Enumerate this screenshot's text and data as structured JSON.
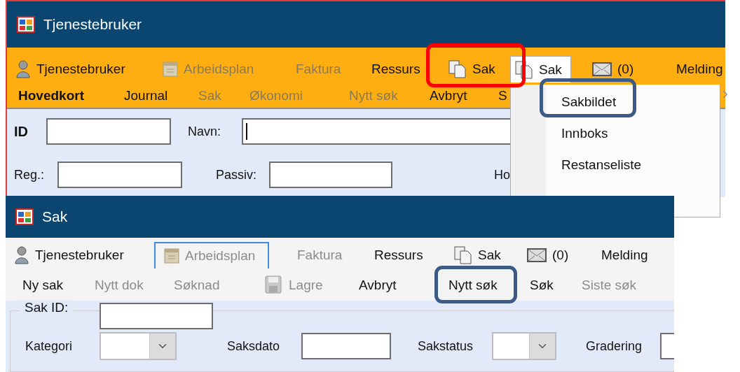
{
  "main_window": {
    "title": "Tjenestebruker",
    "nav": [
      {
        "label": "Tjenestebruker",
        "kind": "person",
        "disabled": false,
        "selected": false
      },
      {
        "label": "Arbeidsplan",
        "kind": "calendar",
        "disabled": true,
        "selected": false
      },
      {
        "label": "Faktura",
        "kind": "plain",
        "disabled": true,
        "selected": false
      },
      {
        "label": "Ressurs",
        "kind": "plain",
        "disabled": false,
        "selected": false
      },
      {
        "label": "Sak",
        "kind": "document",
        "disabled": false,
        "selected": false
      },
      {
        "label": "Sak",
        "kind": "document",
        "disabled": false,
        "selected": true
      },
      {
        "label": "(0)",
        "kind": "mail",
        "disabled": false,
        "selected": false
      },
      {
        "label": "Melding",
        "kind": "plain",
        "disabled": false,
        "selected": false
      }
    ],
    "actions": [
      {
        "label": "Hovedkort",
        "disabled": false,
        "selected": true
      },
      {
        "label": "Journal",
        "disabled": false,
        "selected": false
      },
      {
        "label": "Sak",
        "disabled": true,
        "selected": false
      },
      {
        "label": "Økonomi",
        "disabled": true,
        "selected": false
      },
      {
        "label": "Nytt søk",
        "disabled": true,
        "selected": false
      },
      {
        "label": "Avbryt",
        "disabled": false,
        "selected": false
      },
      {
        "label": "S",
        "disabled": false,
        "selected": false
      }
    ],
    "form_rows": [
      [
        {
          "label": "ID",
          "strong": true,
          "focused": false
        },
        {
          "label": "Navn:",
          "strong": false,
          "focused": true
        }
      ],
      [
        {
          "label": "Reg.:",
          "strong": false,
          "focused": false
        },
        {
          "label": "Passiv:",
          "strong": false,
          "focused": false
        }
      ]
    ],
    "cut_label": "Ho",
    "menu": [
      "Sakbildet",
      "Innboks",
      "Restanseliste"
    ]
  },
  "case_window": {
    "title": "Sak",
    "nav": [
      {
        "label": "Tjenestebruker",
        "kind": "person",
        "disabled": false,
        "selected": false
      },
      {
        "label": "Arbeidsplan",
        "kind": "calendar",
        "disabled": true,
        "selected": true
      },
      {
        "label": "Faktura",
        "kind": "plain",
        "disabled": true,
        "selected": false
      },
      {
        "label": "Ressurs",
        "kind": "plain",
        "disabled": false,
        "selected": false
      },
      {
        "label": "Sak",
        "kind": "document",
        "disabled": false,
        "selected": false
      },
      {
        "label": "(0)",
        "kind": "mail",
        "disabled": false,
        "selected": false
      },
      {
        "label": "Melding",
        "kind": "plain",
        "disabled": false,
        "selected": false
      }
    ],
    "actions": [
      {
        "label": "Ny sak",
        "kind": "plain",
        "disabled": false
      },
      {
        "label": "Nytt dok",
        "kind": "plain",
        "disabled": true
      },
      {
        "label": "Søknad",
        "kind": "plain",
        "disabled": true
      },
      {
        "label": "Lagre",
        "kind": "save",
        "disabled": true
      },
      {
        "label": "Avbryt",
        "kind": "plain",
        "disabled": false
      },
      {
        "label": "Nytt søk",
        "kind": "plain",
        "disabled": false
      },
      {
        "label": "Søk",
        "kind": "plain",
        "disabled": false
      },
      {
        "label": "Siste søk",
        "kind": "plain",
        "disabled": true
      }
    ],
    "group_label": "Sak ID:",
    "fields": [
      {
        "label": "Kategori",
        "kind": "combo"
      },
      {
        "label": "Saksdato",
        "kind": "text"
      },
      {
        "label": "Sakstatus",
        "kind": "combo"
      },
      {
        "label": "Gradering",
        "kind": "text"
      }
    ]
  },
  "annotations": [
    {
      "color": "#ff0000"
    },
    {
      "color": "#3b5b86"
    },
    {
      "color": "#3b5b86"
    }
  ]
}
